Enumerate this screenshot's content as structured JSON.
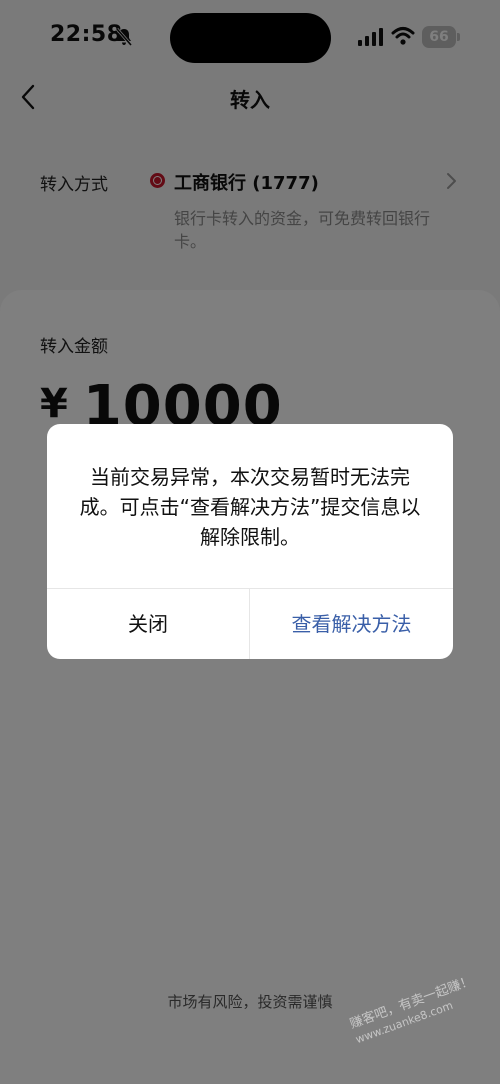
{
  "status_bar": {
    "time": "22:58",
    "battery": "66",
    "icons": [
      "bell-muted-icon",
      "cellular-signal-icon",
      "wifi-icon",
      "battery-icon"
    ]
  },
  "nav": {
    "title": "转入",
    "back_icon": "chevron-left-icon"
  },
  "transfer_method": {
    "label": "转入方式",
    "bank_icon": "icbc-logo-icon",
    "bank_name": "工商银行 (1777)",
    "note": "银行卡转入的资金，可免费转回银行卡。",
    "chevron_icon": "chevron-right-icon",
    "brand_color": "#c7162b"
  },
  "amount": {
    "label": "转入金额",
    "currency": "¥",
    "value": "10000"
  },
  "footer": {
    "risk_note": "市场有风险，投资需谨慎"
  },
  "dialog": {
    "message": "当前交易异常，本次交易暂时无法完成。可点击“查看解决方法”提交信息以解除限制。",
    "close_label": "关闭",
    "solution_label": "查看解决方法",
    "accent_color": "#3a5fa8"
  },
  "watermark": {
    "line1": "赚客吧，有卖一起赚！",
    "line2": "www.zuanke8.com"
  }
}
